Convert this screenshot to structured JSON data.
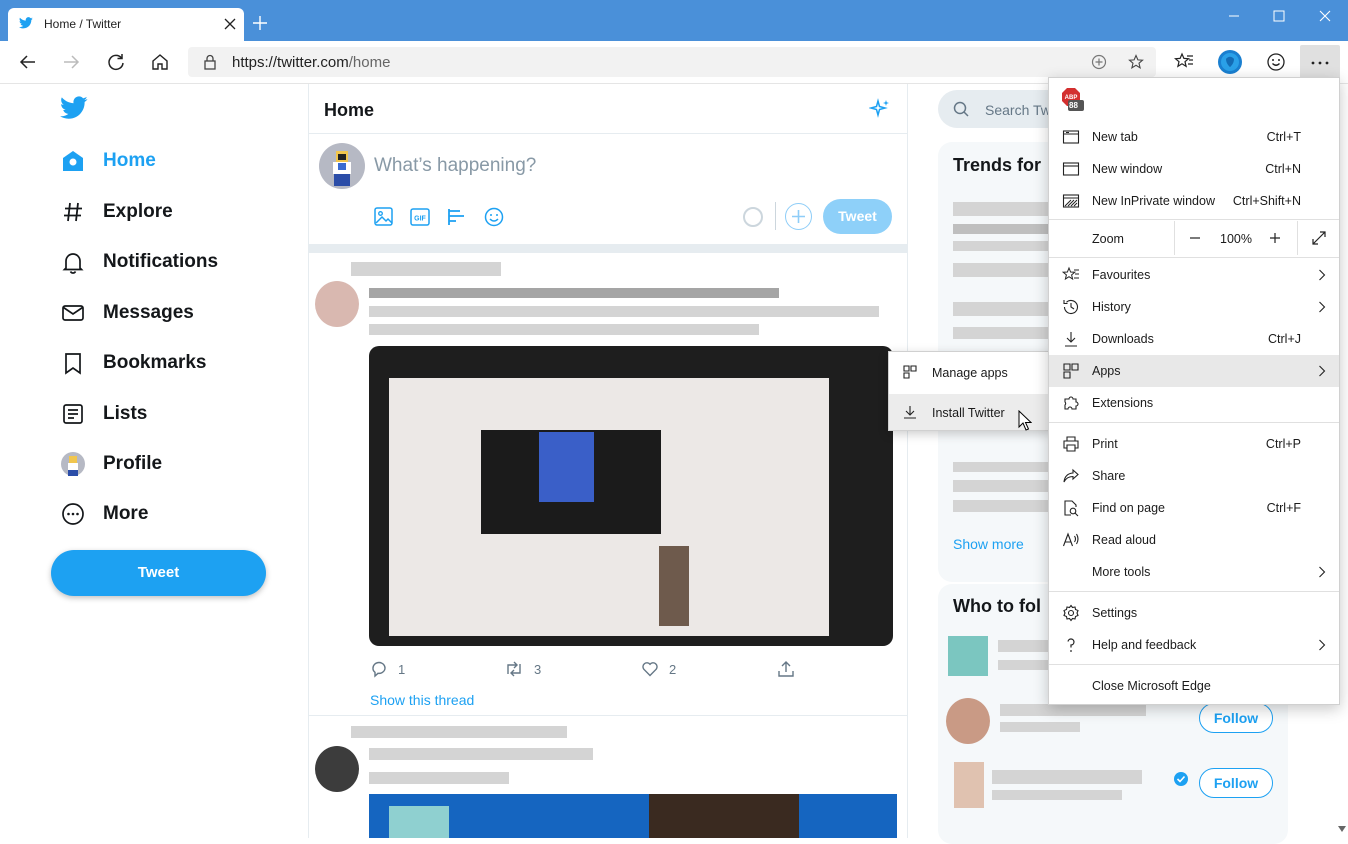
{
  "browser": {
    "tab_title": "Home / Twitter",
    "url_main": "https://twitter.com",
    "url_path": "/home",
    "accent": "#4a90d9"
  },
  "twitter": {
    "brand_color": "#1da1f2",
    "nav": [
      {
        "label": "Home",
        "icon": "home-icon",
        "active": true
      },
      {
        "label": "Explore",
        "icon": "hashtag-icon"
      },
      {
        "label": "Notifications",
        "icon": "bell-icon"
      },
      {
        "label": "Messages",
        "icon": "envelope-icon"
      },
      {
        "label": "Bookmarks",
        "icon": "bookmark-icon"
      },
      {
        "label": "Lists",
        "icon": "list-icon"
      },
      {
        "label": "Profile",
        "icon": "avatar"
      },
      {
        "label": "More",
        "icon": "more-circle-icon"
      }
    ],
    "tweet_button": "Tweet",
    "header_title": "Home",
    "compose_placeholder": "What’s happening?",
    "compose_tweet_button": "Tweet",
    "tweet": {
      "replies": "1",
      "retweets": "3",
      "likes": "2",
      "show_thread": "Show this thread"
    },
    "search_placeholder": "Search Tw",
    "trends_title": "Trends for",
    "show_more": "Show more",
    "who_to_follow_title": "Who to fol",
    "follow_label": "Follow"
  },
  "edge_menu": {
    "extension_badge": "88",
    "items": [
      {
        "label": "New tab",
        "shortcut": "Ctrl+T",
        "icon": "new-tab-icon"
      },
      {
        "label": "New window",
        "shortcut": "Ctrl+N",
        "icon": "new-window-icon"
      },
      {
        "label": "New InPrivate window",
        "shortcut": "Ctrl+Shift+N",
        "icon": "inprivate-icon"
      },
      {
        "label": "Favourites",
        "icon": "favourites-icon"
      },
      {
        "label": "History",
        "icon": "history-icon"
      },
      {
        "label": "Downloads",
        "shortcut": "Ctrl+J",
        "icon": "download-icon"
      },
      {
        "label": "Apps",
        "icon": "apps-icon"
      },
      {
        "label": "Extensions",
        "icon": "extensions-icon"
      },
      {
        "label": "Print",
        "shortcut": "Ctrl+P",
        "icon": "print-icon"
      },
      {
        "label": "Share",
        "icon": "share-icon"
      },
      {
        "label": "Find on page",
        "shortcut": "Ctrl+F",
        "icon": "find-icon"
      },
      {
        "label": "Read aloud",
        "icon": "read-aloud-icon"
      },
      {
        "label": "More tools"
      },
      {
        "label": "Settings",
        "icon": "settings-icon"
      },
      {
        "label": "Help and feedback",
        "icon": "help-icon"
      },
      {
        "label": "Close Microsoft Edge"
      }
    ],
    "zoom_label": "Zoom",
    "zoom_value": "100%"
  },
  "apps_submenu": {
    "items": [
      {
        "label": "Manage apps",
        "icon": "apps-icon"
      },
      {
        "label": "Install Twitter",
        "icon": "download-icon"
      }
    ]
  }
}
